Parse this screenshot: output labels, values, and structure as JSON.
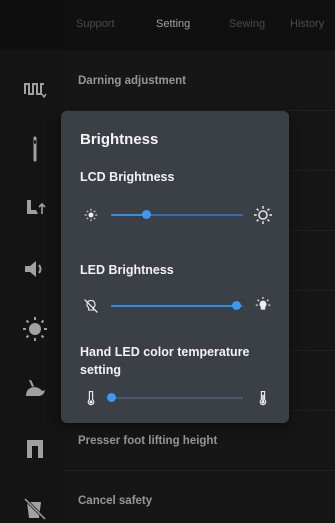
{
  "tabs": {
    "support": "Support",
    "setting": "Setting",
    "sewing": "Sewing",
    "history": "History"
  },
  "rows": [
    {
      "label": "Darning adjustment",
      "icon": "darning-icon"
    },
    {
      "label": "",
      "icon": "needle-icon"
    },
    {
      "label": "",
      "icon": "presser-foot-up-icon"
    },
    {
      "label": "",
      "icon": "speaker-icon"
    },
    {
      "label": "",
      "icon": "brightness-icon"
    },
    {
      "label": "",
      "icon": "rabbit-speed-icon"
    },
    {
      "label": "Presser foot lifting height",
      "icon": "presser-foot-icon"
    },
    {
      "label": "Cancel safety",
      "icon": "cancel-safety-icon"
    }
  ],
  "modal": {
    "title": "Brightness",
    "lcd": {
      "label": "LCD Brightness",
      "value_fraction": 0.27
    },
    "led": {
      "label": "LED Brightness",
      "value_fraction": 0.95
    },
    "temp": {
      "label": "Hand LED color temperature setting",
      "value_fraction": 0.0
    }
  },
  "colors": {
    "accent": "#2f8fe8",
    "modal_bg": "#3b4046",
    "screen_bg": "#1b1b1b"
  }
}
